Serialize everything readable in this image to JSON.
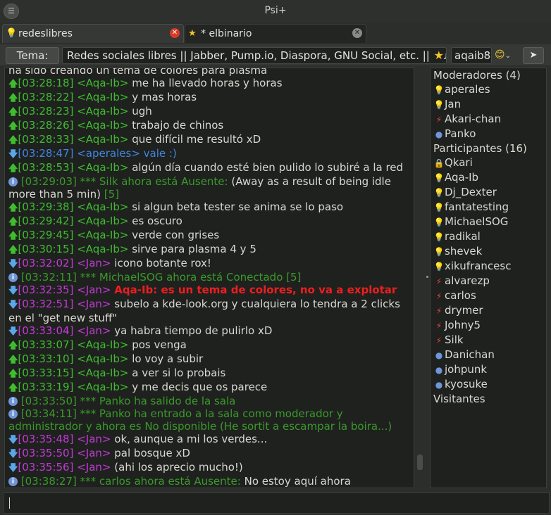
{
  "window": {
    "title": "Psi+"
  },
  "tabs": [
    {
      "label": "redeslibres",
      "icon": "bulb-icon"
    },
    {
      "label": "* elbinario",
      "icon": "star-icon"
    }
  ],
  "topic": {
    "button_label": "Tema:",
    "text": "Redes sociales libres || Jabber, Pump.io, Diaspora, GNU Social, etc. || Nue",
    "nickname": "aqaib8"
  },
  "chat": {
    "partial_top": "ha sido creando un tema de colores para plasma",
    "messages": [
      {
        "kind": "up",
        "time": "[03:28:18]",
        "nick": "<Aqa-Ib>",
        "text": "me ha llevado horas y horas"
      },
      {
        "kind": "up",
        "time": "[03:28:22]",
        "nick": "<Aqa-Ib>",
        "text": "y mas horas"
      },
      {
        "kind": "up",
        "time": "[03:28:23]",
        "nick": "<Aqa-Ib>",
        "text": "ugh"
      },
      {
        "kind": "up",
        "time": "[03:28:26]",
        "nick": "<Aqa-Ib>",
        "text": "trabajo de chinos"
      },
      {
        "kind": "up",
        "time": "[03:28:33]",
        "nick": "<Aqa-Ib>",
        "text": "que difícil me resultó xD"
      },
      {
        "kind": "down-ap",
        "time": "[03:28:47]",
        "nick": "<aperales>",
        "text": "vale :)"
      },
      {
        "kind": "up",
        "time": "[03:28:53]",
        "nick": "<Aqa-Ib>",
        "text": "algún día cuando esté bien pulido lo subiré a la red"
      },
      {
        "kind": "info",
        "time": "[03:29:03]",
        "status": "*** Silk ahora está Ausente:",
        "text": "(Away as a result of being idle more than 5 min)",
        "count": "[5]"
      },
      {
        "kind": "up",
        "time": "[03:29:38]",
        "nick": "<Aqa-Ib>",
        "text": "si algun beta tester se anima se lo paso"
      },
      {
        "kind": "up",
        "time": "[03:29:42]",
        "nick": "<Aqa-Ib>",
        "text": "es oscuro"
      },
      {
        "kind": "up",
        "time": "[03:29:45]",
        "nick": "<Aqa-Ib>",
        "text": "verde con grises"
      },
      {
        "kind": "up",
        "time": "[03:30:15]",
        "nick": "<Aqa-Ib>",
        "text": "sirve para plasma 4 y 5"
      },
      {
        "kind": "down",
        "time": "[03:32:02]",
        "nick": "<Jan>",
        "text": "icono botante rox!"
      },
      {
        "kind": "info",
        "time": "[03:32:11]",
        "status": "*** MichaelSOG ahora está Conectado",
        "text": "",
        "count": "[5]"
      },
      {
        "kind": "down-hl",
        "time": "[03:32:35]",
        "nick": "<Jan>",
        "text": "Aqa-Ib: es un tema de colores, no va a explotar"
      },
      {
        "kind": "down",
        "time": "[03:32:51]",
        "nick": "<Jan>",
        "text": "subelo a kde-look.org y cualquiera lo tendra a 2 clicks en el \"get new stuff\""
      },
      {
        "kind": "down",
        "time": "[03:33:04]",
        "nick": "<Jan>",
        "text": "ya habra tiempo de pulirlo xD"
      },
      {
        "kind": "up",
        "time": "[03:33:07]",
        "nick": "<Aqa-Ib>",
        "text": "pos venga"
      },
      {
        "kind": "up",
        "time": "[03:33:10]",
        "nick": "<Aqa-Ib>",
        "text": "lo voy a subir"
      },
      {
        "kind": "up",
        "time": "[03:33:15]",
        "nick": "<Aqa-Ib>",
        "text": "a ver si lo probais"
      },
      {
        "kind": "up",
        "time": "[03:33:19]",
        "nick": "<Aqa-Ib>",
        "text": "y me decis que os parece"
      },
      {
        "kind": "info",
        "time": "[03:33:50]",
        "status": "*** Panko ha salido de la sala",
        "text": "",
        "count": ""
      },
      {
        "kind": "info",
        "time": "[03:34:11]",
        "status": "*** Panko ha entrado a la sala como moderador y administrador y ahora es No disponible (He sortit a escampar la boira...)",
        "text": "",
        "count": ""
      },
      {
        "kind": "down",
        "time": "[03:35:48]",
        "nick": "<Jan>",
        "text": "ok, aunque a mi los verdes..."
      },
      {
        "kind": "down",
        "time": "[03:35:50]",
        "nick": "<Jan>",
        "text": "pal bosque xD"
      },
      {
        "kind": "down",
        "time": "[03:35:56]",
        "nick": "<Jan>",
        "text": "(ahi los aprecio mucho!)"
      },
      {
        "kind": "info",
        "time": "[03:38:27]",
        "status": "*** carlos ahora está Ausente:",
        "text": "No estoy aquí ahora",
        "count": ""
      }
    ]
  },
  "roster": {
    "groups": [
      {
        "title": "Moderadores  (4)",
        "members": [
          {
            "name": "aperales",
            "icon": "bulb-icon"
          },
          {
            "name": "Jan",
            "icon": "bulb-icon"
          },
          {
            "name": "Akari-chan",
            "icon": "away-icon"
          },
          {
            "name": "Panko",
            "icon": "dnd-icon"
          }
        ]
      },
      {
        "title": "Participantes  (16)",
        "members": [
          {
            "name": "Qkari",
            "icon": "lock-icon"
          },
          {
            "name": "Aqa-Ib",
            "icon": "bulb-icon"
          },
          {
            "name": "Dj_Dexter",
            "icon": "bulb-icon"
          },
          {
            "name": "fantatesting",
            "icon": "bulb-icon"
          },
          {
            "name": "MichaelSOG",
            "icon": "bulb-icon"
          },
          {
            "name": "radikal",
            "icon": "bulb-icon"
          },
          {
            "name": "shevek",
            "icon": "bulb-icon"
          },
          {
            "name": "xikufrancesc",
            "icon": "bulb-icon"
          },
          {
            "name": "alvarezp",
            "icon": "away-icon"
          },
          {
            "name": "carlos",
            "icon": "away-icon"
          },
          {
            "name": "drymer",
            "icon": "away-icon"
          },
          {
            "name": "Johny5",
            "icon": "away-icon"
          },
          {
            "name": "Silk",
            "icon": "away-icon"
          },
          {
            "name": "Danichan",
            "icon": "dnd-icon"
          },
          {
            "name": "johpunk",
            "icon": "dnd-icon"
          },
          {
            "name": "kyosuke",
            "icon": "dnd-icon"
          }
        ]
      },
      {
        "title": "Visitantes",
        "members": []
      }
    ]
  },
  "colors": {
    "background": "#2b2e2b",
    "own_nick": "#3fbd2f",
    "other_nick": "#c43ad6",
    "system": "#3a9a2a",
    "highlight": "#ee1e1e",
    "link": "#3f86e0"
  }
}
